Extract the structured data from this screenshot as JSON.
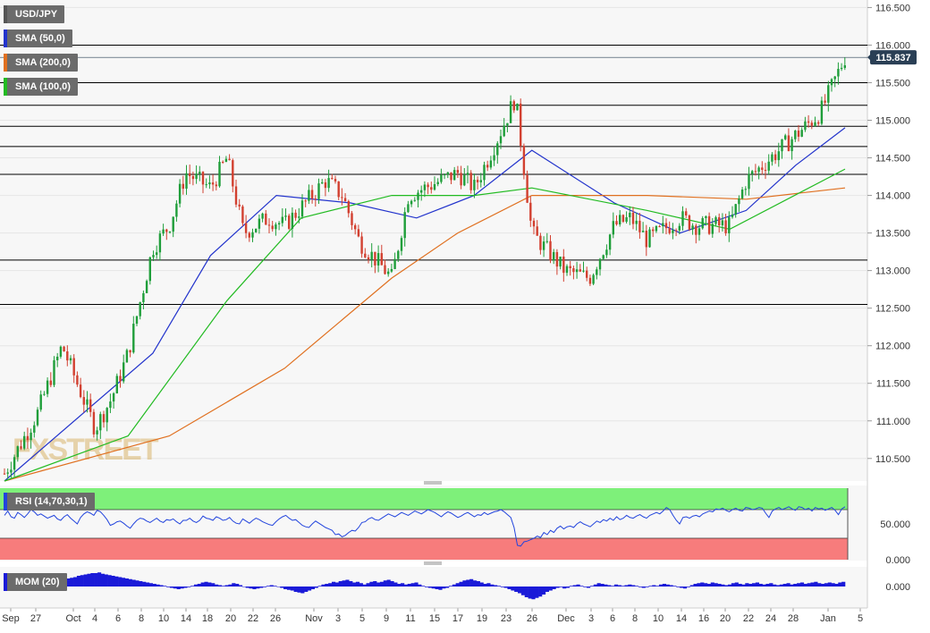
{
  "chart_data": {
    "type": "candlestick",
    "symbol": "USD/JPY",
    "current_price": "115.837",
    "price_axis": {
      "ylim": [
        110.2,
        116.6
      ],
      "ticks": [
        "116.500",
        "116.000",
        "115.500",
        "115.000",
        "114.500",
        "114.000",
        "113.500",
        "113.000",
        "112.500",
        "112.000",
        "111.500",
        "111.000",
        "110.500"
      ]
    },
    "horizontal_levels": [
      116.0,
      115.5,
      115.2,
      114.92,
      114.65,
      114.28,
      113.14,
      112.55
    ],
    "date_axis": {
      "labels": [
        "Sep",
        "27",
        "Oct",
        "4",
        "6",
        "8",
        "10",
        "14",
        "18",
        "20",
        "22",
        "26",
        "Nov",
        "3",
        "5",
        "9",
        "11",
        "15",
        "17",
        "19",
        "23",
        "26",
        "Dec",
        "3",
        "6",
        "8",
        "10",
        "14",
        "16",
        "20",
        "22",
        "24",
        "28",
        "Jan",
        "5"
      ]
    },
    "price_anchors": [
      {
        "date": "Sep 23",
        "price": 110.3
      },
      {
        "date": "Sep 27",
        "price": 111.1
      },
      {
        "date": "Sep 30",
        "price": 112.0
      },
      {
        "date": "Oct 4",
        "price": 110.9
      },
      {
        "date": "Oct 6",
        "price": 111.3
      },
      {
        "date": "Oct 8",
        "price": 111.9
      },
      {
        "date": "Oct 11",
        "price": 113.3
      },
      {
        "date": "Oct 13",
        "price": 113.6
      },
      {
        "date": "Oct 15",
        "price": 114.3
      },
      {
        "date": "Oct 18",
        "price": 114.1
      },
      {
        "date": "Oct 20",
        "price": 114.5
      },
      {
        "date": "Oct 22",
        "price": 113.5
      },
      {
        "date": "Oct 25",
        "price": 113.7
      },
      {
        "date": "Oct 27",
        "price": 113.6
      },
      {
        "date": "Nov 1",
        "price": 114.2
      },
      {
        "date": "Nov 3",
        "price": 114.0
      },
      {
        "date": "Nov 5",
        "price": 113.4
      },
      {
        "date": "Nov 9",
        "price": 112.9
      },
      {
        "date": "Nov 11",
        "price": 114.0
      },
      {
        "date": "Nov 15",
        "price": 114.2
      },
      {
        "date": "Nov 17",
        "price": 114.3
      },
      {
        "date": "Nov 19",
        "price": 114.1
      },
      {
        "date": "Nov 22",
        "price": 114.8
      },
      {
        "date": "Nov 24",
        "price": 115.3
      },
      {
        "date": "Nov 26",
        "price": 113.5
      },
      {
        "date": "Nov 30",
        "price": 113.0
      },
      {
        "date": "Dec 3",
        "price": 112.9
      },
      {
        "date": "Dec 6",
        "price": 113.6
      },
      {
        "date": "Dec 8",
        "price": 113.7
      },
      {
        "date": "Dec 10",
        "price": 113.4
      },
      {
        "date": "Dec 14",
        "price": 113.7
      },
      {
        "date": "Dec 16",
        "price": 113.6
      },
      {
        "date": "Dec 20",
        "price": 113.6
      },
      {
        "date": "Dec 22",
        "price": 114.2
      },
      {
        "date": "Dec 24",
        "price": 114.4
      },
      {
        "date": "Dec 28",
        "price": 114.8
      },
      {
        "date": "Dec 31",
        "price": 115.1
      },
      {
        "date": "Jan 3",
        "price": 115.84
      }
    ],
    "sma_series": [
      {
        "name": "SMA (50,0)",
        "color": "#2233cc",
        "points": [
          [
            "Sep 23",
            110.2
          ],
          [
            "Oct 11",
            111.9
          ],
          [
            "Oct 18",
            113.2
          ],
          [
            "Oct 26",
            114.0
          ],
          [
            "Nov 4",
            113.9
          ],
          [
            "Nov 12",
            113.7
          ],
          [
            "Nov 19",
            114.0
          ],
          [
            "Nov 26",
            114.6
          ],
          [
            "Dec 6",
            113.9
          ],
          [
            "Dec 14",
            113.5
          ],
          [
            "Dec 22",
            113.8
          ],
          [
            "Dec 28",
            114.4
          ],
          [
            "Jan 3",
            114.9
          ]
        ]
      },
      {
        "name": "SMA (200,0)",
        "color": "#e07020",
        "points": [
          [
            "Sep 23",
            110.2
          ],
          [
            "Oct 13",
            110.8
          ],
          [
            "Oct 27",
            111.7
          ],
          [
            "Nov 9",
            112.9
          ],
          [
            "Nov 17",
            113.5
          ],
          [
            "Nov 26",
            114.0
          ],
          [
            "Dec 10",
            114.0
          ],
          [
            "Dec 22",
            113.95
          ],
          [
            "Jan 3",
            114.1
          ]
        ]
      },
      {
        "name": "SMA (100,0)",
        "color": "#22bb22",
        "points": [
          [
            "Sep 23",
            110.2
          ],
          [
            "Oct 8",
            110.8
          ],
          [
            "Oct 20",
            112.6
          ],
          [
            "Oct 29",
            113.7
          ],
          [
            "Nov 9",
            114.0
          ],
          [
            "Nov 19",
            114.0
          ],
          [
            "Nov 26",
            114.1
          ],
          [
            "Dec 10",
            113.8
          ],
          [
            "Dec 20",
            113.55
          ],
          [
            "Jan 3",
            114.35
          ]
        ]
      }
    ],
    "rsi": {
      "label": "RSI (14,70,30,1)",
      "ylim": [
        0,
        100
      ],
      "overbought": 70,
      "oversold": 30,
      "ticks": [
        "50.000",
        "0.000"
      ],
      "last": 74,
      "values": [
        62,
        68,
        60,
        58,
        66,
        63,
        59,
        64,
        70,
        67,
        62,
        64,
        61,
        58,
        60,
        62,
        57,
        55,
        60,
        63,
        58,
        54,
        50,
        59,
        64,
        67,
        65,
        62,
        69,
        67,
        62,
        56,
        48,
        50,
        53,
        54,
        51,
        47,
        44,
        50,
        55,
        58,
        57,
        54,
        52,
        55,
        58,
        54,
        52,
        56,
        55,
        57,
        53,
        50,
        55,
        55,
        58,
        54,
        52,
        55,
        61,
        58,
        57,
        55,
        60,
        58,
        55,
        56,
        59,
        54,
        51,
        50,
        57,
        54,
        51,
        55,
        58,
        56,
        53,
        51,
        49,
        48,
        53,
        57,
        60,
        62,
        58,
        55,
        56,
        52,
        48,
        46,
        45,
        50,
        54,
        51,
        48,
        45,
        43,
        41,
        35,
        36,
        32,
        34,
        38,
        41,
        40,
        45,
        52,
        53,
        57,
        59,
        56,
        55,
        58,
        61,
        64,
        62,
        60,
        63,
        66,
        64,
        62,
        65,
        68,
        66,
        64,
        67,
        70,
        68,
        66,
        63,
        60,
        64,
        67,
        65,
        62,
        59,
        61,
        64,
        66,
        63,
        60,
        63,
        62,
        66,
        63,
        65,
        67,
        68,
        70,
        67,
        63,
        59,
        45,
        20,
        19,
        25,
        26,
        28,
        30,
        33,
        31,
        38,
        35,
        41,
        38,
        44,
        47,
        43,
        46,
        47,
        45,
        50,
        53,
        50,
        48,
        46,
        50,
        54,
        52,
        56,
        54,
        58,
        55,
        60,
        56,
        58,
        62,
        59,
        58,
        61,
        63,
        60,
        58,
        62,
        64,
        66,
        64,
        68,
        73,
        70,
        62,
        55,
        50,
        59,
        60,
        58,
        61,
        62,
        60,
        64,
        66,
        68,
        67,
        71,
        70,
        72,
        69,
        67,
        70,
        72,
        69,
        68,
        73,
        72,
        70,
        71,
        73,
        72,
        65,
        59,
        68,
        71,
        73,
        70,
        72,
        74,
        71,
        69,
        74,
        73,
        70,
        72,
        68,
        73,
        71,
        72,
        69,
        71,
        73,
        69,
        63,
        71,
        74
      ]
    },
    "momentum": {
      "label": "MOM (20)",
      "ticks": [
        "0.000"
      ],
      "values": [
        0.6,
        0.8,
        0.9,
        0.7,
        0.6,
        0.4,
        0.5,
        0.4,
        0.6,
        0.3,
        0.2,
        0.1,
        -0.1,
        0.2,
        0.4,
        0.5,
        0.8,
        1.0,
        1.2,
        1.3,
        1.4,
        1.6,
        1.7,
        1.8,
        1.9,
        2.0,
        2.0,
        2.1,
        1.9,
        1.8,
        1.7,
        1.6,
        1.5,
        1.4,
        1.3,
        1.2,
        1.1,
        1.0,
        0.9,
        0.8,
        0.7,
        0.6,
        0.5,
        0.4,
        0.3,
        0.2,
        0.1,
        -0.1,
        -0.2,
        -0.3,
        -0.4,
        -0.3,
        -0.2,
        -0.1,
        0.1,
        0.3,
        0.4,
        0.6,
        0.7,
        0.6,
        0.5,
        0.3,
        0.2,
        0.1,
        0.2,
        0.3,
        0.5,
        0.4,
        0.2,
        0.0,
        -0.2,
        -0.3,
        -0.4,
        -0.3,
        -0.2,
        -0.1,
        0.1,
        0.2,
        0.1,
        0.0,
        -0.2,
        -0.4,
        -0.5,
        -0.6,
        -0.8,
        -0.9,
        -1.0,
        -0.8,
        -0.6,
        -0.4,
        -0.2,
        0.1,
        0.3,
        0.4,
        0.5,
        0.7,
        0.6,
        0.8,
        0.9,
        1.0,
        0.8,
        0.6,
        0.7,
        0.5,
        0.3,
        0.5,
        0.7,
        0.8,
        0.6,
        0.7,
        0.9,
        1.0,
        0.8,
        0.6,
        0.4,
        0.5,
        0.3,
        0.4,
        0.5,
        0.6,
        0.3,
        0.1,
        -0.1,
        -0.2,
        -0.3,
        -0.4,
        -0.5,
        -0.3,
        -0.2,
        0.1,
        0.3,
        0.5,
        0.7,
        0.9,
        1.0,
        1.1,
        0.9,
        0.8,
        0.6,
        0.4,
        0.5,
        0.3,
        0.2,
        0.1,
        -0.1,
        -0.2,
        -0.4,
        -0.6,
        -0.8,
        -1.0,
        -1.3,
        -1.6,
        -1.8,
        -1.9,
        -1.7,
        -1.5,
        -1.2,
        -0.8,
        -0.6,
        -0.4,
        -0.2,
        -0.1,
        -0.3,
        -0.2,
        0.1,
        0.2,
        0.3,
        0.1,
        -0.1,
        -0.2,
        0.1,
        0.3,
        0.5,
        0.4,
        0.3,
        0.2,
        0.1,
        0.3,
        0.2,
        0.1,
        0.2,
        0.3,
        0.2,
        0.1,
        -0.1,
        -0.2,
        -0.1,
        0.1,
        0.2,
        0.1,
        0.3,
        0.4,
        0.3,
        0.2,
        0.1,
        -0.1,
        -0.2,
        -0.3,
        -0.1,
        0.2,
        0.4,
        0.5,
        0.6,
        0.5,
        0.4,
        0.6,
        0.5,
        0.4,
        0.3,
        0.2,
        0.3,
        0.5,
        0.6,
        0.4,
        0.3,
        0.5,
        0.4,
        0.5,
        0.6,
        0.4,
        0.3,
        0.4,
        0.5,
        0.3,
        0.2,
        0.3,
        0.4,
        0.5,
        0.3,
        0.4,
        0.5,
        0.6,
        0.4,
        0.5,
        0.6,
        0.7,
        0.5,
        0.4,
        0.5,
        0.6,
        0.5,
        0.4,
        0.6,
        0.7
      ]
    },
    "watermark": "FXSTREET",
    "colors": {
      "bull": "#1f9e3a",
      "bear": "#d24030",
      "rsi_line": "#2244dd",
      "rsi_overbought_fill": "#7ef07a",
      "rsi_oversold_fill": "#f77c7c",
      "momentum": "#1a1ad8",
      "price_tag": "#2a3f55",
      "grid": "#e6e6e6",
      "level": "#000000"
    }
  },
  "legend": [
    {
      "label": "USD/JPY",
      "color": "#555555"
    },
    {
      "label": "SMA (50,0)",
      "color": "#2233cc"
    },
    {
      "label": "SMA (200,0)",
      "color": "#e07020"
    },
    {
      "label": "SMA (100,0)",
      "color": "#22bb22"
    }
  ]
}
